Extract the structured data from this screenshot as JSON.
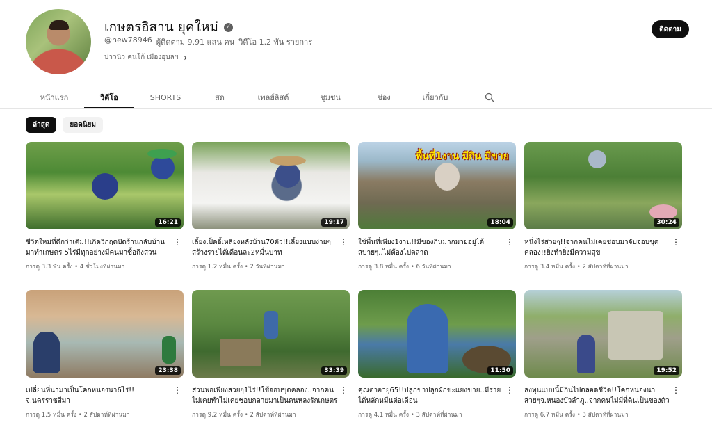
{
  "channel": {
    "name": "เกษตรอิสาน ยุคใหม่",
    "handle": "@new78946",
    "subscribers": "ผู้ติดตาม 9.91 แสน คน",
    "videos_count": "วิดีโอ 1.2 พัน รายการ",
    "description": "บ่าวนิว คนโก้ เมืองอุบลฯ",
    "subscribe_label": "ติดตาม"
  },
  "tabs": [
    {
      "label": "หน้าแรก"
    },
    {
      "label": "วิดีโอ"
    },
    {
      "label": "SHORTS"
    },
    {
      "label": "สด"
    },
    {
      "label": "เพลย์ลิสต์"
    },
    {
      "label": "ชุมชน"
    },
    {
      "label": "ช่อง"
    },
    {
      "label": "เกี่ยวกับ"
    }
  ],
  "chips": [
    {
      "label": "ล่าสุด"
    },
    {
      "label": "ยอดนิยม"
    }
  ],
  "videos": [
    {
      "title": "ชีวิตใหม่ที่ดีกว่าเดิม!!เกิดวิกฤตปิดร้านกลับบ้านมาทำเกษตร 5ไร่มีทุกอย่างมีคนมาซื้อถึงสวน",
      "views": "การดู 3.3 พัน ครั้ง",
      "age": "4 ชั่วโมงที่ผ่านมา",
      "duration": "16:21"
    },
    {
      "title": "เลี้ยงเป็ดอี้เหลียงหลังบ้าน70ตัว!!เลี้ยงแบบง่ายๆสร้างรายได้เดือนละ2หมื่นบาท",
      "views": "การดู 1.2 หมื่น ครั้ง",
      "age": "2 วันที่ผ่านมา",
      "duration": "19:17"
    },
    {
      "title": "ใช้พื้นที่เพียง1งาน!!มีของกินมากมายอยู่ได้สบายๆ..ไม่ต้องไปตลาด",
      "views": "การดู 3.8 หมื่น ครั้ง",
      "age": "6 วันที่ผ่านมา",
      "duration": "18:04",
      "overlay": "พื้นที่1งาน มีกิน มีขาย"
    },
    {
      "title": "หนึ่งไร่สวยๆ!!จากคนไม่เคยชอบมาจับจอบขุดคลอง!!ยิ่งทำยิ่งมีความสุข",
      "views": "การดู 3.4 หมื่น ครั้ง",
      "age": "2 สัปดาห์ที่ผ่านมา",
      "duration": "30:24"
    },
    {
      "title": "เปลี่ยนที่นามาเป็นโคกหนองนา6ไร่!!จ.นครราชสีมา",
      "views": "การดู 1.5 หมื่น ครั้ง",
      "age": "2 สัปดาห์ที่ผ่านมา",
      "duration": "23:38"
    },
    {
      "title": "สวนพอเพียงสวยๆ1ไร่!!ใช้จอบขุดคลอง..จากคนไม่เคยทำไม่เคยชอบกลายมาเป็นคนหลงรักเกษตร",
      "views": "การดู 9.2 หมื่น ครั้ง",
      "age": "2 สัปดาห์ที่ผ่านมา",
      "duration": "33:39"
    },
    {
      "title": "คุณตาอายุ65!!ปลูกข่าปลูกผักขะแยงขาย..มีรายได้หลักหมื่นต่อเดือน",
      "views": "การดู 4.1 หมื่น ครั้ง",
      "age": "3 สัปดาห์ที่ผ่านมา",
      "duration": "11:50"
    },
    {
      "title": "ลงทุนแบบนี้มีกินไปตลอดชีวิต!!โคกหนองนาสวยๆจ.หนองบัวลำภู..จากคนไม่มีที่ดินเป็นของตัวเอง",
      "views": "การดู 6.7 หมื่น ครั้ง",
      "age": "3 สัปดาห์ที่ผ่านมา",
      "duration": "19:52"
    }
  ]
}
